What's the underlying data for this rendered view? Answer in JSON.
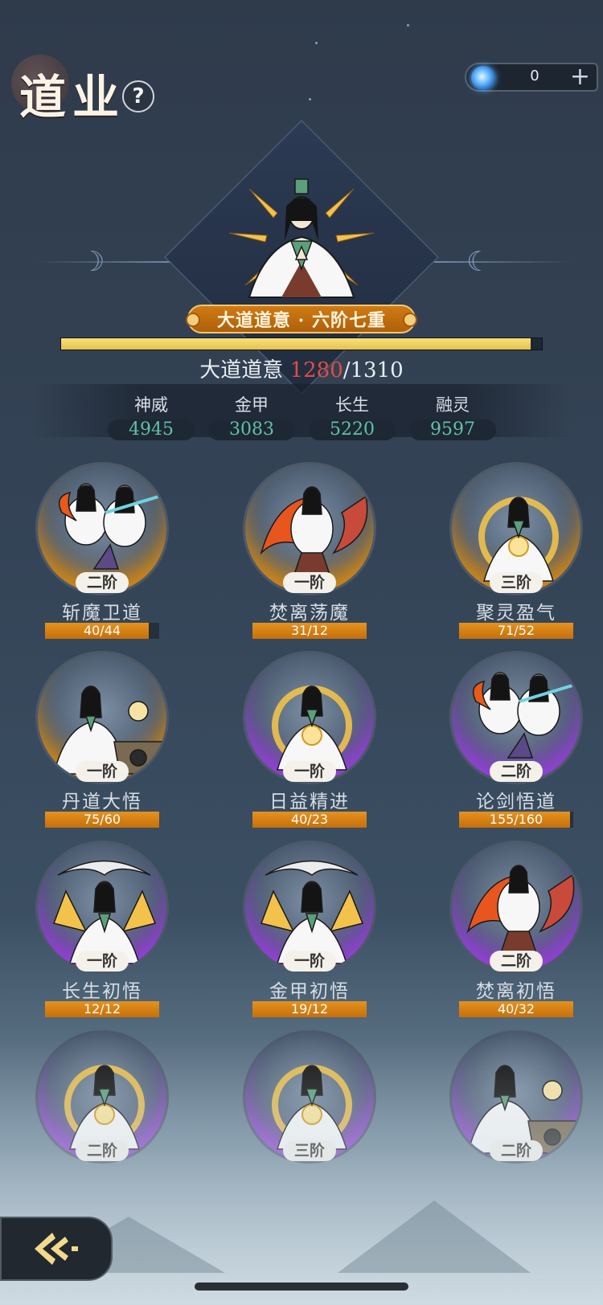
{
  "header": {
    "title": "道业",
    "help_label": "?",
    "currency": {
      "icon": "spirit-orb-icon",
      "value": "0",
      "plus_label": "+"
    }
  },
  "dao": {
    "rank": "大道道意 · 六阶七重",
    "progress_label": "大道道意",
    "current": 1280,
    "max": 1310,
    "current_text": "1280",
    "max_text": "/1310"
  },
  "stats": [
    {
      "label": "神威",
      "value": "4945"
    },
    {
      "label": "金甲",
      "value": "3083"
    },
    {
      "label": "长生",
      "value": "5220"
    },
    {
      "label": "融灵",
      "value": "9597"
    }
  ],
  "skills": [
    {
      "name": "斩魔卫道",
      "tier": "二阶",
      "count": "40/44",
      "fill": 0.909,
      "glow": "gold",
      "art": "duo-sword"
    },
    {
      "name": "焚离荡魔",
      "tier": "一阶",
      "count": "31/12",
      "fill": 1,
      "glow": "gold",
      "art": "fire"
    },
    {
      "name": "聚灵盈气",
      "tier": "三阶",
      "count": "71/52",
      "fill": 1,
      "glow": "gold",
      "art": "orb"
    },
    {
      "name": "丹道大悟",
      "tier": "一阶",
      "count": "75/60",
      "fill": 1,
      "glow": "gold",
      "art": "cauldron"
    },
    {
      "name": "日益精进",
      "tier": "一阶",
      "count": "40/23",
      "fill": 1,
      "glow": "purple",
      "art": "orb"
    },
    {
      "name": "论剑悟道",
      "tier": "二阶",
      "count": "155/160",
      "fill": 0.969,
      "glow": "purple",
      "art": "duo-sword"
    },
    {
      "name": "长生初悟",
      "tier": "一阶",
      "count": "12/12",
      "fill": 1,
      "glow": "purple",
      "art": "swirl"
    },
    {
      "name": "金甲初悟",
      "tier": "一阶",
      "count": "19/12",
      "fill": 1,
      "glow": "purple",
      "art": "swirl"
    },
    {
      "name": "焚离初悟",
      "tier": "二阶",
      "count": "40/32",
      "fill": 1,
      "glow": "purple",
      "art": "fire"
    },
    {
      "name": "",
      "tier": "二阶",
      "count": "",
      "fill": 0,
      "glow": "purple",
      "art": "orb"
    },
    {
      "name": "",
      "tier": "三阶",
      "count": "",
      "fill": 0,
      "glow": "purple",
      "art": "orb"
    },
    {
      "name": "",
      "tier": "二阶",
      "count": "",
      "fill": 0,
      "glow": "purple",
      "art": "cauldron"
    }
  ],
  "footer": {
    "back_icon": "back-arrow-icon"
  },
  "colors": {
    "accent": "#e6c04e",
    "stat_value": "#5fc2a4",
    "current_value": "#e24b44",
    "bar": "#d98a12"
  }
}
